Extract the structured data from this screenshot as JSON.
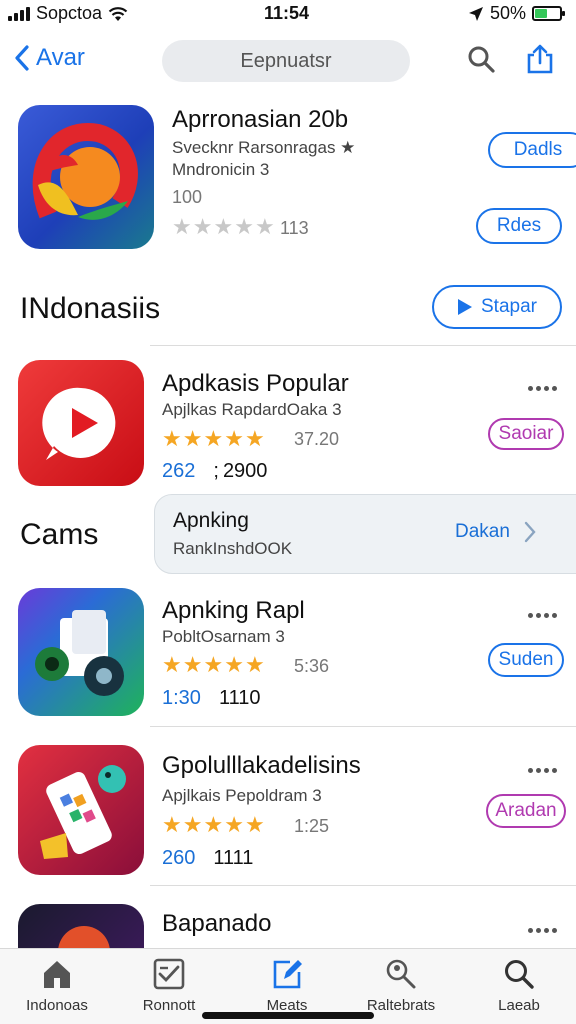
{
  "status_bar": {
    "carrier": "Sopctoa",
    "time": "11:54",
    "battery": "50%",
    "battery_level": 0.5
  },
  "nav": {
    "back_label": "Avar",
    "search_text": "Eepnuatsr"
  },
  "featured": {
    "title": "Aprronasian 20b",
    "subtitle": "Svecknr Rarsonragas ★",
    "subtitle2": "Mndronicin 3",
    "count": "100",
    "rating_count": "113",
    "rating": 0,
    "btn1": "Dadls",
    "btn2": "Rdes"
  },
  "section1": {
    "title": "INdonasiis",
    "button": "Stapar"
  },
  "apps": [
    {
      "title": "Apdkasis Popular",
      "subtitle": "Apjlkas RapdardOaka 3",
      "rating_value": "37.20",
      "num1": "262",
      "num2": "2900",
      "button": "Saoiar",
      "icon_colors": [
        "#e21b23",
        "#c80d15"
      ]
    },
    {
      "title": "Apnking Rapl",
      "subtitle": "PobltOsarnam 3",
      "rating_value": "5:36",
      "num1": "1:30",
      "num2": "1110",
      "button": "Suden",
      "icon_colors": [
        "#2b6bd6",
        "#1fb35a"
      ]
    },
    {
      "title": "Gpolulllakadelisins",
      "subtitle": "Apjlkais Pepoldram 3",
      "rating_value": "1:25",
      "num1": "260",
      "num2": "1111",
      "button": "Aradan",
      "icon_colors": [
        "#d41a2c",
        "#8a0e3a"
      ]
    },
    {
      "title": "Bapanado",
      "subtitle": ""
    }
  ],
  "rank_section": {
    "label": "Cams",
    "card_title": "Apnking",
    "card_subtitle": "RankInshdOOK",
    "card_button": "Dakan"
  },
  "tabs": [
    {
      "label": "Indonoas",
      "icon": "home-icon"
    },
    {
      "label": "Ronnott",
      "icon": "checklist-icon"
    },
    {
      "label": "Meats",
      "icon": "edit-icon"
    },
    {
      "label": "Raltebrats",
      "icon": "search-people-icon"
    },
    {
      "label": "Laeab",
      "icon": "search-icon"
    }
  ],
  "colors": {
    "accent": "#1a73e8",
    "star": "#f5a623",
    "star_empty": "#c8c8c8",
    "purple": "#b03ab0"
  }
}
